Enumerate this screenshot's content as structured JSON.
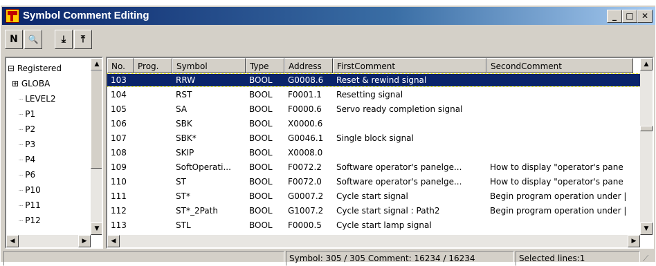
{
  "window": {
    "title": "Symbol Comment Editing",
    "controls": {
      "minimize": "_",
      "maximize": "□",
      "close": "✕"
    }
  },
  "toolbar": {
    "buttons": [
      {
        "name": "new-button",
        "glyph": "N"
      },
      {
        "name": "find-button",
        "glyph": "🔍"
      },
      {
        "name": "import-button",
        "glyph": "⤓"
      },
      {
        "name": "export-button",
        "glyph": "⤒"
      }
    ]
  },
  "tree": {
    "items": [
      {
        "label": "Registered",
        "prefix": "⊟",
        "indent": 0
      },
      {
        "label": "GLOBA",
        "prefix": "⊞",
        "indent": 1
      },
      {
        "label": "LEVEL2",
        "prefix": "",
        "indent": 1
      },
      {
        "label": "P1",
        "prefix": "",
        "indent": 1
      },
      {
        "label": "P2",
        "prefix": "",
        "indent": 1
      },
      {
        "label": "P3",
        "prefix": "",
        "indent": 1
      },
      {
        "label": "P4",
        "prefix": "",
        "indent": 1
      },
      {
        "label": "P6",
        "prefix": "",
        "indent": 1
      },
      {
        "label": "P10",
        "prefix": "",
        "indent": 1
      },
      {
        "label": "P11",
        "prefix": "",
        "indent": 1
      },
      {
        "label": "P12",
        "prefix": "",
        "indent": 1
      }
    ]
  },
  "table": {
    "columns": [
      "No.",
      "Prog.",
      "Symbol",
      "Type",
      "Address",
      "FirstComment",
      "SecondComment"
    ],
    "rows": [
      {
        "no": "103",
        "prog": "",
        "symbol": "RRW",
        "type": "BOOL",
        "address": "G0008.6",
        "first": "Reset & rewind signal",
        "second": "",
        "selected": true
      },
      {
        "no": "104",
        "prog": "",
        "symbol": "RST",
        "type": "BOOL",
        "address": "F0001.1",
        "first": "Resetting signal",
        "second": ""
      },
      {
        "no": "105",
        "prog": "",
        "symbol": "SA",
        "type": "BOOL",
        "address": "F0000.6",
        "first": "Servo ready completion signal",
        "second": ""
      },
      {
        "no": "106",
        "prog": "",
        "symbol": "SBK",
        "type": "BOOL",
        "address": "X0000.6",
        "first": "",
        "second": ""
      },
      {
        "no": "107",
        "prog": "",
        "symbol": "SBK*",
        "type": "BOOL",
        "address": "G0046.1",
        "first": "Single block signal",
        "second": ""
      },
      {
        "no": "108",
        "prog": "",
        "symbol": "SKIP",
        "type": "BOOL",
        "address": "X0008.0",
        "first": "",
        "second": ""
      },
      {
        "no": "109",
        "prog": "",
        "symbol": "SoftOperati...",
        "type": "BOOL",
        "address": "F0072.2",
        "first": "Software operator's panelge...",
        "second": "How to display \"operator's pane"
      },
      {
        "no": "110",
        "prog": "",
        "symbol": "ST",
        "type": "BOOL",
        "address": "F0072.0",
        "first": "Software operator's panelge...",
        "second": "How to display \"operator's pane"
      },
      {
        "no": "111",
        "prog": "",
        "symbol": "ST*",
        "type": "BOOL",
        "address": "G0007.2",
        "first": "Cycle start signal",
        "second": "Begin program operation under |"
      },
      {
        "no": "112",
        "prog": "",
        "symbol": "ST*_2Path",
        "type": "BOOL",
        "address": "G1007.2",
        "first": "Cycle start signal : Path2",
        "second": "Begin program operation under |"
      },
      {
        "no": "113",
        "prog": "",
        "symbol": "STL",
        "type": "BOOL",
        "address": "F0000.5",
        "first": "Cycle start lamp signal",
        "second": ""
      }
    ]
  },
  "status": {
    "counts": "Symbol: 305 / 305 Comment: 16234 / 16234",
    "selected": "Selected lines:1"
  }
}
